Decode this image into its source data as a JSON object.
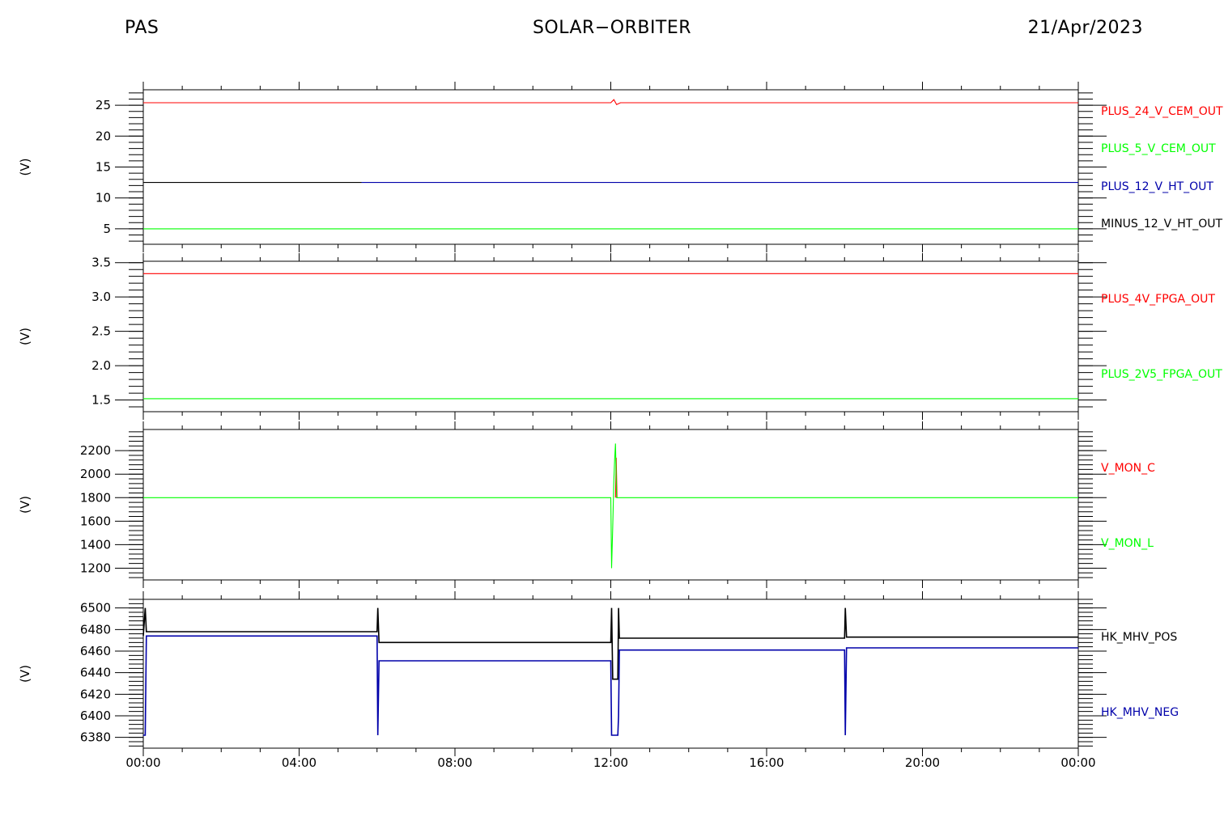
{
  "header": {
    "left": "PAS",
    "center": "SOLAR−ORBITER",
    "right": "21/Apr/2023"
  },
  "x_axis": {
    "tick_labels": [
      "00:00",
      "04:00",
      "08:00",
      "12:00",
      "16:00",
      "20:00",
      "00:00"
    ],
    "range_hours": [
      0,
      24
    ]
  },
  "chart_data": [
    {
      "type": "line",
      "ylabel": "(V)",
      "ylim": [
        2.5,
        27.5
      ],
      "yticks": [
        5,
        10,
        15,
        20,
        25
      ],
      "ytick_labels": [
        "5",
        "10",
        "15",
        "20",
        "25"
      ],
      "series": [
        {
          "name": "PLUS_24_V_CEM_OUT",
          "color": "#ff0000",
          "x": [
            0,
            12.0,
            12.08,
            12.15,
            12.25,
            24
          ],
          "y": [
            25.4,
            25.4,
            25.9,
            25.1,
            25.4,
            25.4
          ]
        },
        {
          "name": "PLUS_5_V_CEM_OUT",
          "color": "#00ff00",
          "x": [
            0,
            24
          ],
          "y": [
            5.0,
            5.0
          ]
        },
        {
          "name": "PLUS_12_V_HT_OUT",
          "color": "#0000aa",
          "x": [
            5.6,
            24
          ],
          "y": [
            12.5,
            12.5
          ]
        },
        {
          "name": "MINUS_12_V_HT_OUT",
          "color": "#000000",
          "x": [
            0,
            5.6
          ],
          "y": [
            12.5,
            12.5
          ]
        }
      ]
    },
    {
      "type": "line",
      "ylabel": "(V)",
      "ylim": [
        1.33,
        3.52
      ],
      "yticks": [
        1.5,
        2.0,
        2.5,
        3.0,
        3.5
      ],
      "ytick_labels": [
        "1.5",
        "2.0",
        "2.5",
        "3.0",
        "3.5"
      ],
      "series": [
        {
          "name": "PLUS_4V_FPGA_OUT",
          "color": "#ff0000",
          "x": [
            0,
            24
          ],
          "y": [
            3.34,
            3.34
          ]
        },
        {
          "name": "PLUS_2V5_FPGA_OUT",
          "color": "#00ff00",
          "x": [
            0,
            24
          ],
          "y": [
            1.52,
            1.52
          ]
        }
      ]
    },
    {
      "type": "line",
      "ylabel": "(V)",
      "ylim": [
        1100,
        2380
      ],
      "yticks": [
        1200,
        1400,
        1600,
        1800,
        2000,
        2200
      ],
      "ytick_labels": [
        "1200",
        "1400",
        "1600",
        "1800",
        "2000",
        "2200"
      ],
      "series": [
        {
          "name": "V_MON_C",
          "color": "#ff0000",
          "x": [
            12.12,
            12.14,
            12.16
          ],
          "y": [
            1800,
            2140,
            1800
          ]
        },
        {
          "name": "V_MON_L",
          "color": "#00ff00",
          "x": [
            0,
            12.0,
            12.02,
            12.05,
            12.08,
            12.1,
            12.12,
            12.15,
            12.17,
            24
          ],
          "y": [
            1800,
            1800,
            1200,
            1550,
            1950,
            2130,
            2260,
            1800,
            1800,
            1800
          ]
        }
      ]
    },
    {
      "type": "line",
      "ylabel": "(V)",
      "ylim": [
        6370,
        6508
      ],
      "yticks": [
        6380,
        6400,
        6420,
        6440,
        6460,
        6480,
        6500
      ],
      "ytick_labels": [
        "6380",
        "6400",
        "6420",
        "6440",
        "6460",
        "6480",
        "6500"
      ],
      "series": [
        {
          "name": "HK_MHV_POS",
          "color": "#000000",
          "x": [
            0,
            0.05,
            0.08,
            6.0,
            6.02,
            6.05,
            12.0,
            12.02,
            12.05,
            12.18,
            12.2,
            12.22,
            18.0,
            18.02,
            18.05,
            24
          ],
          "y": [
            6474,
            6500,
            6478,
            6478,
            6500,
            6468,
            6468,
            6500,
            6434,
            6434,
            6500,
            6472,
            6472,
            6500,
            6473,
            6473
          ]
        },
        {
          "name": "HK_MHV_NEG",
          "color": "#0000aa",
          "x": [
            0,
            0.05,
            0.08,
            6.0,
            6.02,
            6.05,
            12.0,
            12.02,
            12.05,
            12.18,
            12.2,
            12.22,
            18.0,
            18.02,
            18.05,
            24
          ],
          "y": [
            6382,
            6382,
            6474,
            6474,
            6382,
            6451,
            6451,
            6382,
            6382,
            6382,
            6400,
            6461,
            6461,
            6382,
            6463,
            6463
          ]
        }
      ]
    }
  ]
}
